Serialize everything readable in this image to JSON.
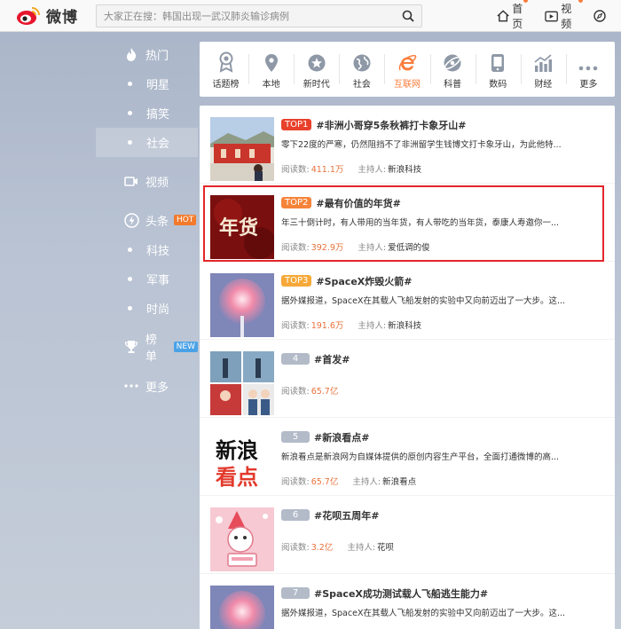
{
  "brand": {
    "name": "微博"
  },
  "search": {
    "placeholder": "大家正在搜：韩国出现一武汉肺炎输诊病例"
  },
  "topnav": [
    {
      "label": "首页",
      "icon": "home-icon"
    },
    {
      "label": "视频",
      "icon": "video-icon"
    }
  ],
  "sidebar": {
    "items": [
      {
        "label": "热门",
        "type": "head",
        "icon": "flame-icon"
      },
      {
        "label": "明星",
        "type": "sub"
      },
      {
        "label": "搞笑",
        "type": "sub"
      },
      {
        "label": "社会",
        "type": "sub",
        "active": true
      },
      {
        "label": "视频",
        "type": "head",
        "icon": "video-icon"
      },
      {
        "label": "头条",
        "type": "head",
        "icon": "lightning-icon",
        "badge": "HOT"
      },
      {
        "label": "科技",
        "type": "sub"
      },
      {
        "label": "军事",
        "type": "sub"
      },
      {
        "label": "时尚",
        "type": "sub"
      },
      {
        "label": "榜单",
        "type": "head",
        "icon": "trophy-icon",
        "badge": "NEW"
      },
      {
        "label": "更多",
        "type": "head",
        "icon": "more-icon"
      }
    ]
  },
  "categories": [
    {
      "label": "话题榜",
      "icon": "medal-icon"
    },
    {
      "label": "本地",
      "icon": "location-icon"
    },
    {
      "label": "新时代",
      "icon": "globe-star-icon"
    },
    {
      "label": "社会",
      "icon": "globe-icon"
    },
    {
      "label": "互联网",
      "icon": "ie-icon",
      "active": true
    },
    {
      "label": "科普",
      "icon": "planet-icon"
    },
    {
      "label": "数码",
      "icon": "phone-icon"
    },
    {
      "label": "财经",
      "icon": "chart-icon"
    },
    {
      "label": "更多",
      "icon": "dots-icon"
    }
  ],
  "labels": {
    "reads": "阅读数:",
    "host": "主持人:"
  },
  "topics": [
    {
      "rank": "TOP1",
      "title": "#非洲小哥穿5条秋裤打卡象牙山#",
      "desc": "零下22度的严寒，仍然阻挡不了非洲留学生钱博文打卡象牙山，为此他特...",
      "reads": "411.1万",
      "host": "新浪科技"
    },
    {
      "rank": "TOP2",
      "title": "#最有价值的年货#",
      "desc": "年三十倒计时，有人带用的当年货，有人带吃的当年货，泰康人寿邀你一...",
      "reads": "392.9万",
      "host": "爱低调的俊"
    },
    {
      "rank": "TOP3",
      "title": "#SpaceX炸毁火箭#",
      "desc": "据外媒报道，SpaceX在其载人飞船发射的实验中又向前迈出了一大步。这...",
      "reads": "191.6万",
      "host": "新浪科技"
    },
    {
      "rank": "4",
      "title": "#首发#",
      "desc": "",
      "reads": "65.7亿",
      "host": ""
    },
    {
      "rank": "5",
      "title": "#新浪看点#",
      "desc": "新浪看点是新浪网为自媒体提供的原创内容生产平台，全面打通微博的高...",
      "reads": "65.7亿",
      "host": "新浪看点"
    },
    {
      "rank": "6",
      "title": "#花呗五周年#",
      "desc": "",
      "reads": "3.2亿",
      "host": "花呗"
    },
    {
      "rank": "7",
      "title": "#SpaceX成功测试载人飞船逃生能力#",
      "desc": "据外媒报道，SpaceX在其载人飞船发射的实验中又向前迈出了一大步。这...",
      "reads": "",
      "host": ""
    }
  ],
  "thumb_texts": {
    "nianhuo": "年货",
    "xinlang1": "新浪",
    "xinlang2": "看点"
  }
}
